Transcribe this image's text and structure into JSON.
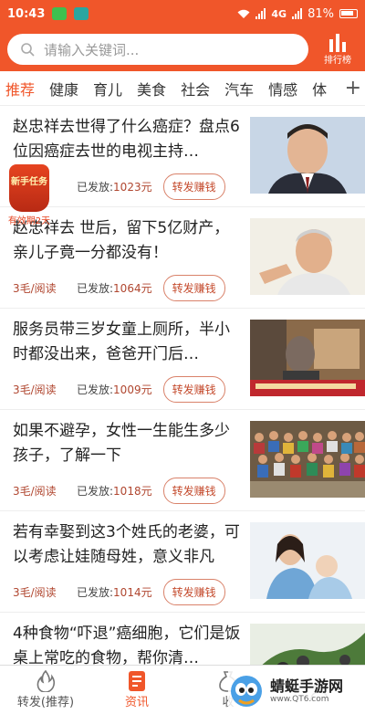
{
  "status_bar": {
    "time": "10:43",
    "network": "4G",
    "battery": "81%"
  },
  "search": {
    "placeholder": "请输入关键词..."
  },
  "ranking": {
    "label": "排行榜"
  },
  "tabs": [
    "推荐",
    "健康",
    "育儿",
    "美食",
    "社会",
    "汽车",
    "情感",
    "体"
  ],
  "tab_more_symbol": "+",
  "badge": {
    "label": "新手任务",
    "expiry": "有效期2天"
  },
  "articles": [
    {
      "title": "赵忠祥去世得了什么癌症？盘点6位因癌症去世的电视主持…",
      "reads": "",
      "posted_label": "已发放:",
      "amount": "1023元",
      "button": "转发赚钱"
    },
    {
      "title": "赵忠祥去 世后，留下5亿财产，亲儿子竟一分都没有！",
      "reads": "3毛/阅读",
      "posted_label": "已发放:",
      "amount": "1064元",
      "button": "转发赚钱"
    },
    {
      "title": "服务员带三岁女童上厕所，半小时都没出来，爸爸开门后…",
      "reads": "3毛/阅读",
      "posted_label": "已发放:",
      "amount": "1009元",
      "button": "转发赚钱"
    },
    {
      "title": "如果不避孕，女性一生能生多少孩子，了解一下",
      "reads": "3毛/阅读",
      "posted_label": "已发放:",
      "amount": "1018元",
      "button": "转发赚钱"
    },
    {
      "title": "若有幸娶到这3个姓氏的老婆，可以考虑让娃随母姓，意义非凡",
      "reads": "3毛/阅读",
      "posted_label": "已发放:",
      "amount": "1014元",
      "button": "转发赚钱"
    },
    {
      "title": "4种食物“吓退”癌细胞，它们是饭桌上常吃的食物，帮你清…",
      "reads": "",
      "posted_label": "",
      "amount": "",
      "button": ""
    }
  ],
  "bottom_nav": {
    "forward": "转发(推荐)",
    "news": "资讯",
    "third": "收"
  },
  "watermark": {
    "name": "蜻蜓手游网",
    "url": "www.QT6.com"
  },
  "colors": {
    "brand": "#f0562a",
    "accent_text": "#b0462f"
  }
}
